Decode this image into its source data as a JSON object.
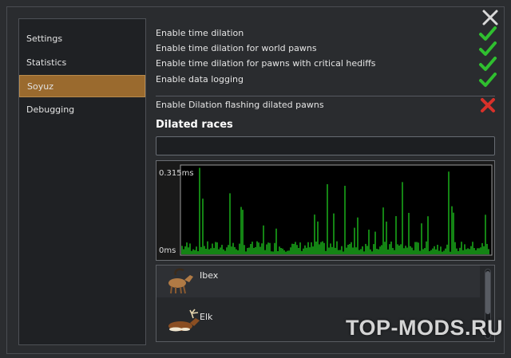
{
  "sidebar": {
    "items": [
      {
        "label": "Settings",
        "active": false
      },
      {
        "label": "Statistics",
        "active": false
      },
      {
        "label": "Soyuz",
        "active": true
      },
      {
        "label": "Debugging",
        "active": false
      }
    ]
  },
  "options": [
    {
      "label": "Enable time dilation",
      "enabled": true,
      "icon": "checkmark-icon"
    },
    {
      "label": "Enable time dilation for world pawns",
      "enabled": true,
      "icon": "checkmark-icon"
    },
    {
      "label": "Enable time dilation for pawns with critical hediffs",
      "enabled": true,
      "icon": "checkmark-icon"
    },
    {
      "label": "Enable data logging",
      "enabled": true,
      "icon": "checkmark-icon"
    },
    {
      "label": "Enable Dilation flashing dilated pawns",
      "enabled": false,
      "icon": "cross-icon"
    }
  ],
  "dilated_races": {
    "title": "Dilated races",
    "search_value": "",
    "graph": {
      "max_label": "0.315ms",
      "min_label": "0ms",
      "line_color": "#22dd22"
    },
    "races": [
      {
        "name": "Ibex",
        "icon": "ibex-icon"
      },
      {
        "name": "Elk",
        "icon": "elk-icon"
      }
    ]
  },
  "watermark": "TOP-MODS.RU",
  "colors": {
    "accent_active": "#9a6a2e",
    "check_green": "#2fbf2f",
    "cross_red": "#d8312a",
    "graph_green": "#22dd22"
  }
}
